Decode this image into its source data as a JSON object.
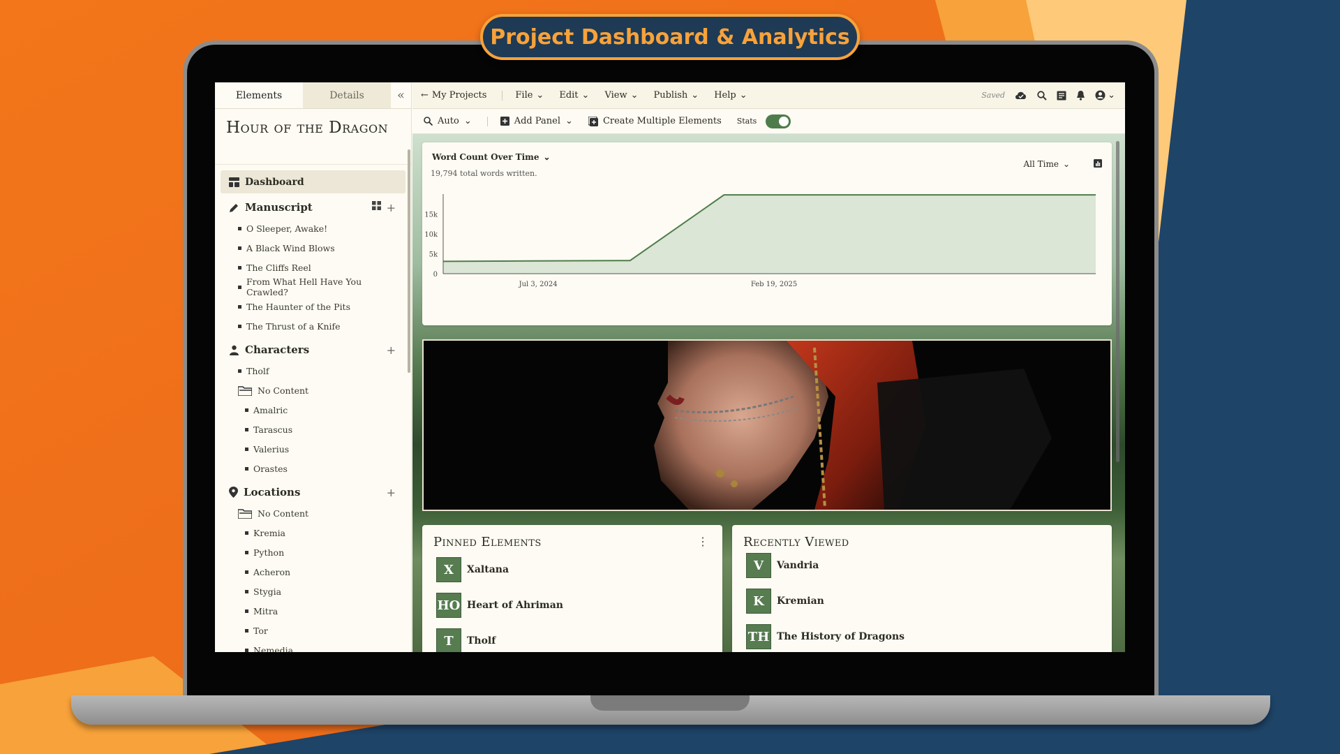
{
  "banner": {
    "title": "Project Dashboard & Analytics"
  },
  "sidebar": {
    "tabs": [
      "Elements",
      "Details"
    ],
    "collapse_glyph": "«",
    "project_title": "Hour of the Dragon",
    "dashboard_label": "Dashboard",
    "manuscript": {
      "label": "Manuscript",
      "items": [
        "O Sleeper, Awake!",
        "A Black Wind Blows",
        "The Cliffs Reel",
        "From What Hell Have You Crawled?",
        "The Haunter of the Pits",
        "The Thrust of a Knife"
      ]
    },
    "characters": {
      "label": "Characters",
      "items": [
        "Tholf"
      ],
      "folder": "No Content",
      "folder_items": [
        "Amalric",
        "Tarascus",
        "Valerius",
        "Orastes"
      ]
    },
    "locations": {
      "label": "Locations",
      "folder": "No Content",
      "folder_items": [
        "Kremia",
        "Python",
        "Acheron",
        "Stygia",
        "Mitra",
        "Tor",
        "Nemedia"
      ]
    }
  },
  "menubar": {
    "back_label": "My Projects",
    "menus": [
      "File",
      "Edit",
      "View",
      "Publish",
      "Help"
    ],
    "saved_label": "Saved"
  },
  "toolbar": {
    "zoom_label": "Auto",
    "add_panel_label": "Add Panel",
    "create_multiple_label": "Create Multiple Elements",
    "stats_label": "Stats",
    "stats_on": true
  },
  "chart_panel": {
    "title": "Word Count Over Time",
    "subtitle": "19,794 total words written.",
    "range_label": "All Time"
  },
  "chart_data": {
    "type": "area",
    "title": "Word Count Over Time",
    "xlabel": "",
    "ylabel": "",
    "x_ticks": [
      "Jul 3, 2024",
      "Feb 19, 2025"
    ],
    "y_ticks": [
      "0",
      "5k",
      "10k",
      "15k"
    ],
    "ylim": [
      0,
      20000
    ],
    "x": [
      "2024-04-01",
      "2024-10-01",
      "2025-01-01",
      "2025-12-31"
    ],
    "values": [
      3100,
      3300,
      19794,
      19794
    ],
    "grid": false,
    "colors": {
      "line": "#4f7c4b",
      "fill": "#dbe6d6"
    }
  },
  "pinned": {
    "title": "Pinned Elements",
    "items": [
      {
        "badge": "X",
        "label": "Xaltana"
      },
      {
        "badge": "HO",
        "label": "Heart of Ahriman"
      },
      {
        "badge": "T",
        "label": "Tholf"
      }
    ]
  },
  "recent": {
    "title": "Recently Viewed",
    "items": [
      {
        "badge": "V",
        "label": "Vandria"
      },
      {
        "badge": "K",
        "label": "Kremian"
      },
      {
        "badge": "TH",
        "label": "The History of Dragons"
      }
    ]
  },
  "colors": {
    "accent": "#4f7c4b",
    "banner_bg": "#1e3a55",
    "banner_text": "#f7a23a",
    "background_orange": "#f07a1c",
    "background_navy": "#1e4468"
  },
  "icons": [
    "back-arrow-icon",
    "cloud-check-icon",
    "search-icon",
    "notes-icon",
    "bell-icon",
    "account-icon",
    "zoom-icon",
    "add-panel-icon",
    "create-multiple-icon",
    "dashboard-icon",
    "pencil-icon",
    "grid-icon",
    "plus-icon",
    "person-icon",
    "folder-icon",
    "location-pin-icon",
    "kebab-icon"
  ]
}
